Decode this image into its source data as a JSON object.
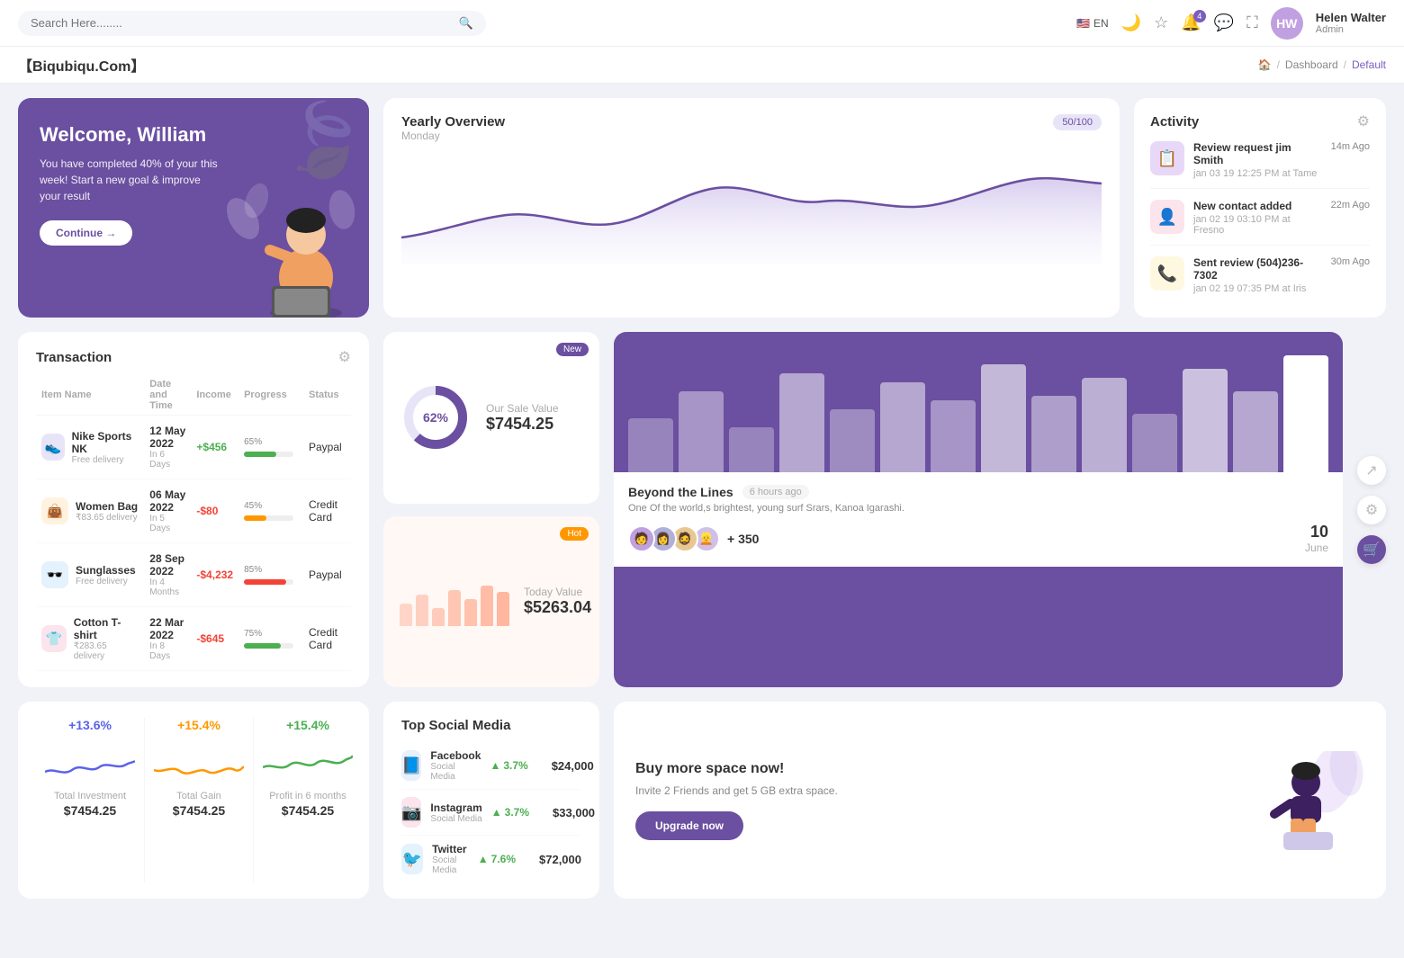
{
  "topnav": {
    "search_placeholder": "Search Here........",
    "lang": "EN",
    "user_name": "Helen Walter",
    "user_role": "Admin",
    "notifications_count": "4"
  },
  "breadcrumb": {
    "brand": "【Biqubiqu.Com】",
    "home": "🏠",
    "sep1": "/",
    "link1": "Dashboard",
    "sep2": "/",
    "link2": "Default"
  },
  "welcome": {
    "title": "Welcome, William",
    "subtitle": "You have completed 40% of your this week! Start a new goal & improve your result",
    "button": "Continue →"
  },
  "yearly": {
    "title": "Yearly Overview",
    "badge": "50/100",
    "subtitle": "Monday"
  },
  "activity": {
    "title": "Activity",
    "items": [
      {
        "title": "Review request jim Smith",
        "sub": "jan 03 19 12:25 PM at Tame",
        "time": "14m Ago",
        "icon": "📋"
      },
      {
        "title": "New contact added",
        "sub": "jan 02 19 03:10 PM at Fresno",
        "time": "22m Ago",
        "icon": "👤"
      },
      {
        "title": "Sent review (504)236-7302",
        "sub": "jan 02 19 07:35 PM at Iris",
        "time": "30m Ago",
        "icon": "📞"
      }
    ]
  },
  "transaction": {
    "title": "Transaction",
    "columns": [
      "Item Name",
      "Date and Time",
      "Income",
      "Progress",
      "Status"
    ],
    "rows": [
      {
        "name": "Nike Sports NK",
        "sub": "Free delivery",
        "date": "12 May 2022",
        "days": "In 6 Days",
        "income": "+$456",
        "income_type": "pos",
        "progress": 65,
        "progress_color": "#4caf50",
        "status": "Paypal",
        "icon": "👟",
        "icon_bg": "#e8e4f8"
      },
      {
        "name": "Women Bag",
        "sub": "₹83.65 delivery",
        "date": "06 May 2022",
        "days": "In 5 Days",
        "income": "-$80",
        "income_type": "neg",
        "progress": 45,
        "progress_color": "#ff9800",
        "status": "Credit Card",
        "icon": "👜",
        "icon_bg": "#fff3e0"
      },
      {
        "name": "Sunglasses",
        "sub": "Free delivery",
        "date": "28 Sep 2022",
        "days": "In 4 Months",
        "income": "-$4,232",
        "income_type": "neg",
        "progress": 85,
        "progress_color": "#f44336",
        "status": "Paypal",
        "icon": "🕶️",
        "icon_bg": "#e3f2fd"
      },
      {
        "name": "Cotton T-shirt",
        "sub": "₹283.65 delivery",
        "date": "22 Mar 2022",
        "days": "In 8 Days",
        "income": "-$645",
        "income_type": "neg",
        "progress": 75,
        "progress_color": "#4caf50",
        "status": "Credit Card",
        "icon": "👕",
        "icon_bg": "#fce4ec"
      }
    ]
  },
  "sale_cards": [
    {
      "badge": "New",
      "badge_type": "new",
      "donut_pct": "62%",
      "label": "Our Sale Value",
      "amount": "$7454.25"
    },
    {
      "badge": "Hot",
      "badge_type": "hot",
      "label": "Today Value",
      "amount": "$5263.04"
    }
  ],
  "beyond": {
    "title": "Beyond the Lines",
    "time": "6 hours ago",
    "desc": "One Of the world,s brightest, young surf Srars, Kanoa Igarashi.",
    "count": "+ 350",
    "date": "10",
    "month": "June"
  },
  "mini_stats": [
    {
      "pct": "+13.6%",
      "color": "blue",
      "label": "Total Investment",
      "value": "$7454.25"
    },
    {
      "pct": "+15.4%",
      "color": "orange",
      "label": "Total Gain",
      "value": "$7454.25"
    },
    {
      "pct": "+15.4%",
      "color": "green",
      "label": "Profit in 6 months",
      "value": "$7454.25"
    }
  ],
  "social": {
    "title": "Top Social Media",
    "items": [
      {
        "name": "Facebook",
        "type": "Social Media",
        "pct": "3.7%",
        "amount": "$24,000",
        "icon": "📘",
        "icon_bg": "#e8f0fe"
      },
      {
        "name": "Instagram",
        "type": "Social Media",
        "pct": "3.7%",
        "amount": "$33,000",
        "icon": "📷",
        "icon_bg": "#fce4ec"
      },
      {
        "name": "Twitter",
        "type": "Social Media",
        "pct": "7.6%",
        "amount": "$72,000",
        "icon": "🐦",
        "icon_bg": "#e3f2fd"
      }
    ]
  },
  "upgrade": {
    "title": "Buy more space now!",
    "desc": "Invite 2 Friends and get 5 GB extra space.",
    "button": "Upgrade now"
  }
}
